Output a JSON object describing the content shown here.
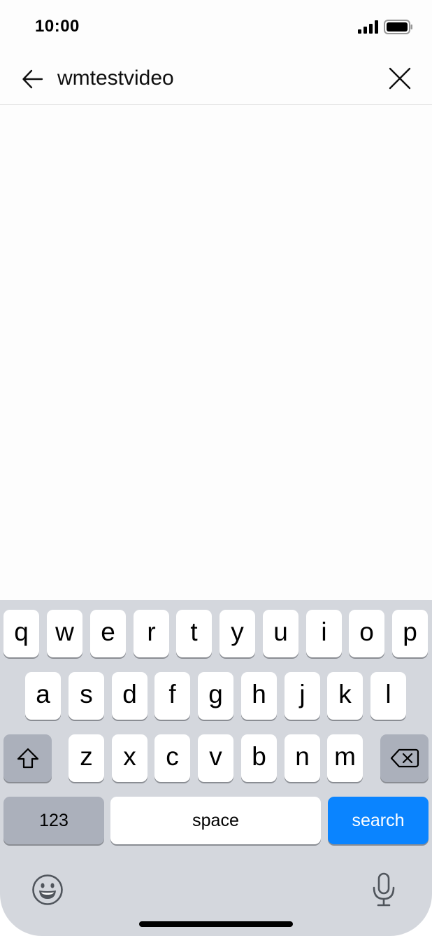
{
  "status_bar": {
    "time": "10:00",
    "signal_icon": "cellular-signal-icon",
    "battery_icon": "battery-full-icon"
  },
  "search": {
    "query": "wmtestvideo",
    "back_icon": "arrow-left-icon",
    "clear_icon": "close-icon"
  },
  "keyboard": {
    "row1": [
      "q",
      "w",
      "e",
      "r",
      "t",
      "y",
      "u",
      "i",
      "o",
      "p"
    ],
    "row2": [
      "a",
      "s",
      "d",
      "f",
      "g",
      "h",
      "j",
      "k",
      "l"
    ],
    "row3": [
      "z",
      "x",
      "c",
      "v",
      "b",
      "n",
      "m"
    ],
    "shift_icon": "shift-icon",
    "delete_icon": "backspace-icon",
    "numbers_label": "123",
    "space_label": "space",
    "search_label": "search",
    "emoji_icon": "emoji-icon",
    "mic_icon": "microphone-icon",
    "accent_color": "#0a84ff"
  }
}
